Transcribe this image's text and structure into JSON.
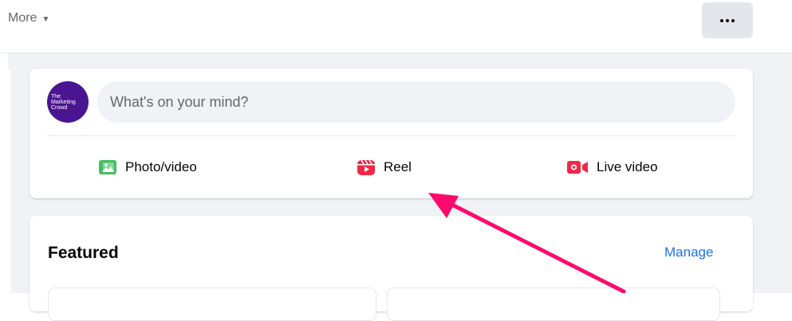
{
  "topbar": {
    "more_label": "More",
    "more_caret": "▼",
    "options_icon": "more-horizontal-icon"
  },
  "composer": {
    "avatar_text": "The\nMarketing\nCrowd",
    "placeholder": "What's on your mind?",
    "actions": [
      {
        "label": "Photo/video",
        "icon": "photo-video-icon",
        "color": "#45bd62"
      },
      {
        "label": "Reel",
        "icon": "reel-icon",
        "color": "#f02849"
      },
      {
        "label": "Live video",
        "icon": "live-video-icon",
        "color": "#f02849"
      }
    ]
  },
  "featured": {
    "title": "Featured",
    "manage_label": "Manage"
  },
  "annotation": {
    "arrow_color": "#ff0a6c",
    "arrow_icon": "pointer-arrow-icon"
  },
  "colors": {
    "accent": "#1b74e4",
    "feed_background": "#f0f2f5",
    "avatar": "#4a1590"
  }
}
